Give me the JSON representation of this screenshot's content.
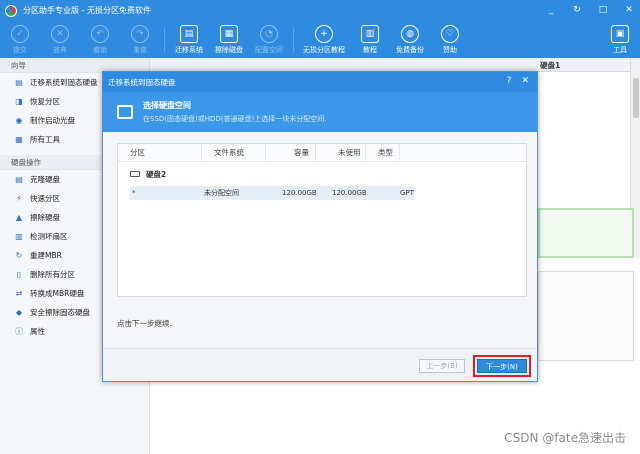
{
  "app": {
    "title": "分区助手专业版 - 无损分区免费软件"
  },
  "window_buttons": [
    "_",
    "↻",
    "□",
    "✕"
  ],
  "toolbar": {
    "items": [
      {
        "label": "提交",
        "icon": "check-icon",
        "glyph": "✓",
        "disabled": true
      },
      {
        "label": "放弃",
        "icon": "cancel-icon",
        "glyph": "✕",
        "disabled": true
      },
      {
        "label": "撤销",
        "icon": "undo-icon",
        "glyph": "↶",
        "disabled": true
      },
      {
        "label": "重做",
        "icon": "redo-icon",
        "glyph": "↷",
        "disabled": true
      },
      {
        "label": "迁移系统",
        "icon": "migrate-os-icon",
        "glyph": "▤",
        "disabled": false
      },
      {
        "label": "擦除磁盘",
        "icon": "wipe-disk-icon",
        "glyph": "▦",
        "disabled": false
      },
      {
        "label": "配置空间",
        "icon": "allocate-space-icon",
        "glyph": "◔",
        "disabled": true
      },
      {
        "label": "无损分区教程",
        "icon": "shield-icon",
        "glyph": "+",
        "disabled": false
      },
      {
        "label": "教程",
        "icon": "book-icon",
        "glyph": "▥",
        "disabled": false
      },
      {
        "label": "免费备份",
        "icon": "backup-icon",
        "glyph": "◍",
        "disabled": false
      },
      {
        "label": "赞助",
        "icon": "heart-icon",
        "glyph": "♡",
        "disabled": false
      },
      {
        "label": "工具",
        "icon": "toolbox-icon",
        "glyph": "▣",
        "disabled": false
      }
    ]
  },
  "sidebar": {
    "wizard_title": "向导",
    "wizard_items": [
      {
        "label": "迁移系统到固态硬盘",
        "glyph": "▤"
      },
      {
        "label": "恢复分区",
        "glyph": "◨"
      },
      {
        "label": "制作启动光盘",
        "glyph": "◉"
      },
      {
        "label": "所有工具",
        "glyph": "▦"
      }
    ],
    "disk_title": "硬盘操作",
    "disk_items": [
      {
        "label": "克隆硬盘",
        "glyph": "▤"
      },
      {
        "label": "快速分区",
        "glyph": "⚡"
      },
      {
        "label": "擦除硬盘",
        "glyph": "▲"
      },
      {
        "label": "检测坏扇区",
        "glyph": "▥"
      },
      {
        "label": "重建MBR",
        "glyph": "↻"
      },
      {
        "label": "删除所有分区",
        "glyph": "▯"
      },
      {
        "label": "转换成MBR硬盘",
        "glyph": "⇄"
      },
      {
        "label": "安全擦除固态硬盘",
        "glyph": "◆"
      },
      {
        "label": "属性",
        "glyph": "ⓘ"
      }
    ]
  },
  "main": {
    "disk_label": "硬盘1"
  },
  "dialog": {
    "title": "迁移系统到固态硬盘",
    "title_buttons": [
      "?",
      "✕"
    ],
    "header_title": "选择硬盘空间",
    "header_desc": "在SSD(固态硬盘)或HDD(普通硬盘)上选择一块未分配空间.",
    "columns": [
      "分区",
      "文件系统",
      "容量",
      "未使用",
      "类型"
    ],
    "disk_name": "硬盘2",
    "rows": [
      {
        "partition": "*",
        "filesystem": "未分配空间",
        "capacity": "120.00GB",
        "unused": "120.00GB",
        "type": "GPT"
      }
    ],
    "hint": "点击下一步继续.",
    "prev_button": "上一步(B)",
    "next_button": "下一步(N)"
  },
  "watermark": "CSDN @fate急速出击"
}
